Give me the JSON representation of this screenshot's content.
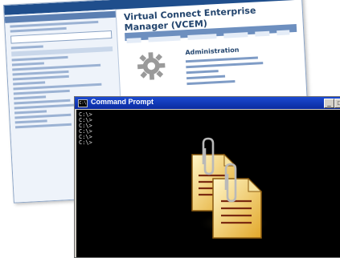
{
  "web_console": {
    "title": "Virtual Connect Enterprise Manager (VCEM)",
    "admin_heading": "Administration"
  },
  "command_prompt": {
    "title": "Command Prompt",
    "icon_text": "C:\\",
    "minimize_glyph": "_",
    "maximize_glyph": "□",
    "lines": [
      "C:\\>",
      "C:\\>",
      "C:\\>",
      "C:\\>",
      "C:\\>",
      "C:\\>"
    ]
  },
  "colors": {
    "titlebar_blue": "#0a2a9f",
    "console_bg": "#000000",
    "web_header": "#1f4e8c",
    "document_yellow": "#f0c040"
  },
  "icons": [
    "gear-icon",
    "document-stack-icon",
    "paperclip-icon"
  ]
}
